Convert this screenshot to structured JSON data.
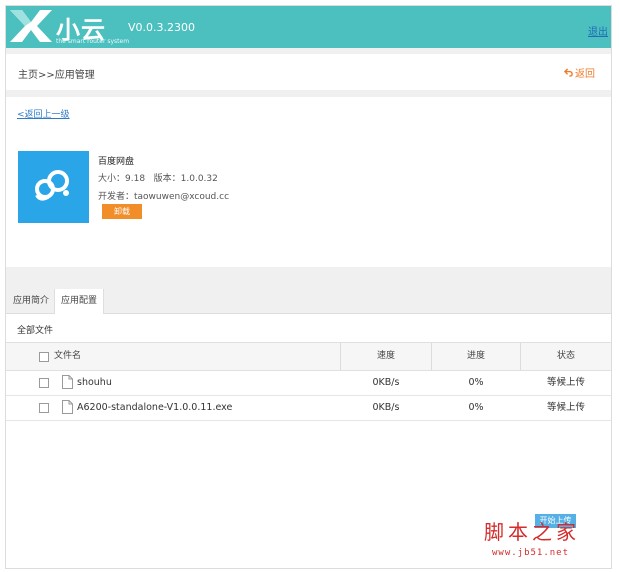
{
  "header": {
    "brand": "小云",
    "tagline": "the smart router system",
    "version": "V0.0.3.2300",
    "logout": "退出"
  },
  "breadcrumb": {
    "text": "主页>>应用管理",
    "back": "返回"
  },
  "app": {
    "back_up": "<返回上一级",
    "name": "百度网盘",
    "size": "大小：9.18",
    "version": "版本：1.0.0.32",
    "developer": "开发者：taowuwen@xcoud.cc",
    "uninstall": "卸载"
  },
  "tabs": [
    {
      "label": "应用简介"
    },
    {
      "label": "应用配置"
    }
  ],
  "files": {
    "section_title": "全部文件",
    "columns": {
      "name": "文件名",
      "speed": "速度",
      "progress": "进度",
      "status": "状态"
    },
    "rows": [
      {
        "name": "shouhu",
        "speed": "0KB/s",
        "progress": "0%",
        "status": "等候上传"
      },
      {
        "name": "A6200-standalone-V1.0.0.11.exe",
        "speed": "0KB/s",
        "progress": "0%",
        "status": "等候上传"
      }
    ],
    "start_upload": "开始上传"
  },
  "watermark": {
    "text": "脚本之家",
    "url": "www.jb51.net"
  },
  "colors": {
    "header": "#4cbfbf",
    "accent": "#f18e2a",
    "app_icon": "#2aa6e8",
    "link": "#2f7ac7"
  },
  "icons": {
    "back": "undo-arrow-icon",
    "file": "document-icon",
    "app": "baidu-cloud-icon"
  }
}
